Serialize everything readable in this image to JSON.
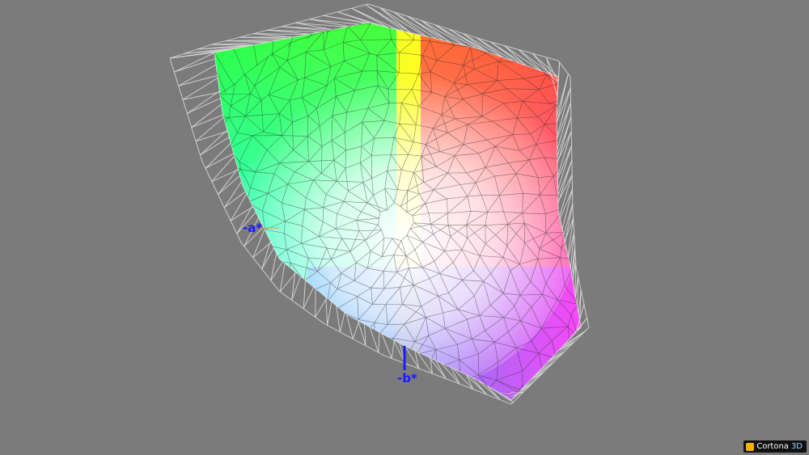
{
  "axes": {
    "a_label": "-a*",
    "b_label": "-b*"
  },
  "viewer": {
    "brand_main": "Cortona",
    "brand_suffix": "3D"
  },
  "colors": {
    "background": "#7b7b7b",
    "axis": "#1a1aff",
    "wireframe_outer": "#e6e6e6",
    "wireframe_inner": "#222222"
  }
}
